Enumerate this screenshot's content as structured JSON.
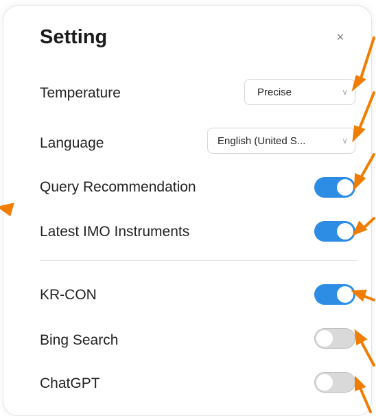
{
  "dialog": {
    "title": "Setting",
    "close_symbol": "×"
  },
  "settings": {
    "temperature": {
      "label": "Temperature",
      "value": "Precise"
    },
    "language": {
      "label": "Language",
      "value": "English (United S..."
    },
    "query_recommendation": {
      "label": "Query Recommendation",
      "state": "on"
    },
    "latest_imo": {
      "label": "Latest IMO Instruments",
      "state": "on"
    },
    "kr_con": {
      "label": "KR-CON",
      "state": "on"
    },
    "bing_search": {
      "label": "Bing Search",
      "state": "off"
    },
    "chatgpt": {
      "label": "ChatGPT",
      "state": "off"
    }
  },
  "colors": {
    "toggle_on": "#2d8ce3",
    "toggle_off": "#d9d9d9",
    "annotation_arrow": "#f07d00"
  },
  "icons": {
    "chevron": "chevron-down-icon",
    "close": "close-icon"
  }
}
